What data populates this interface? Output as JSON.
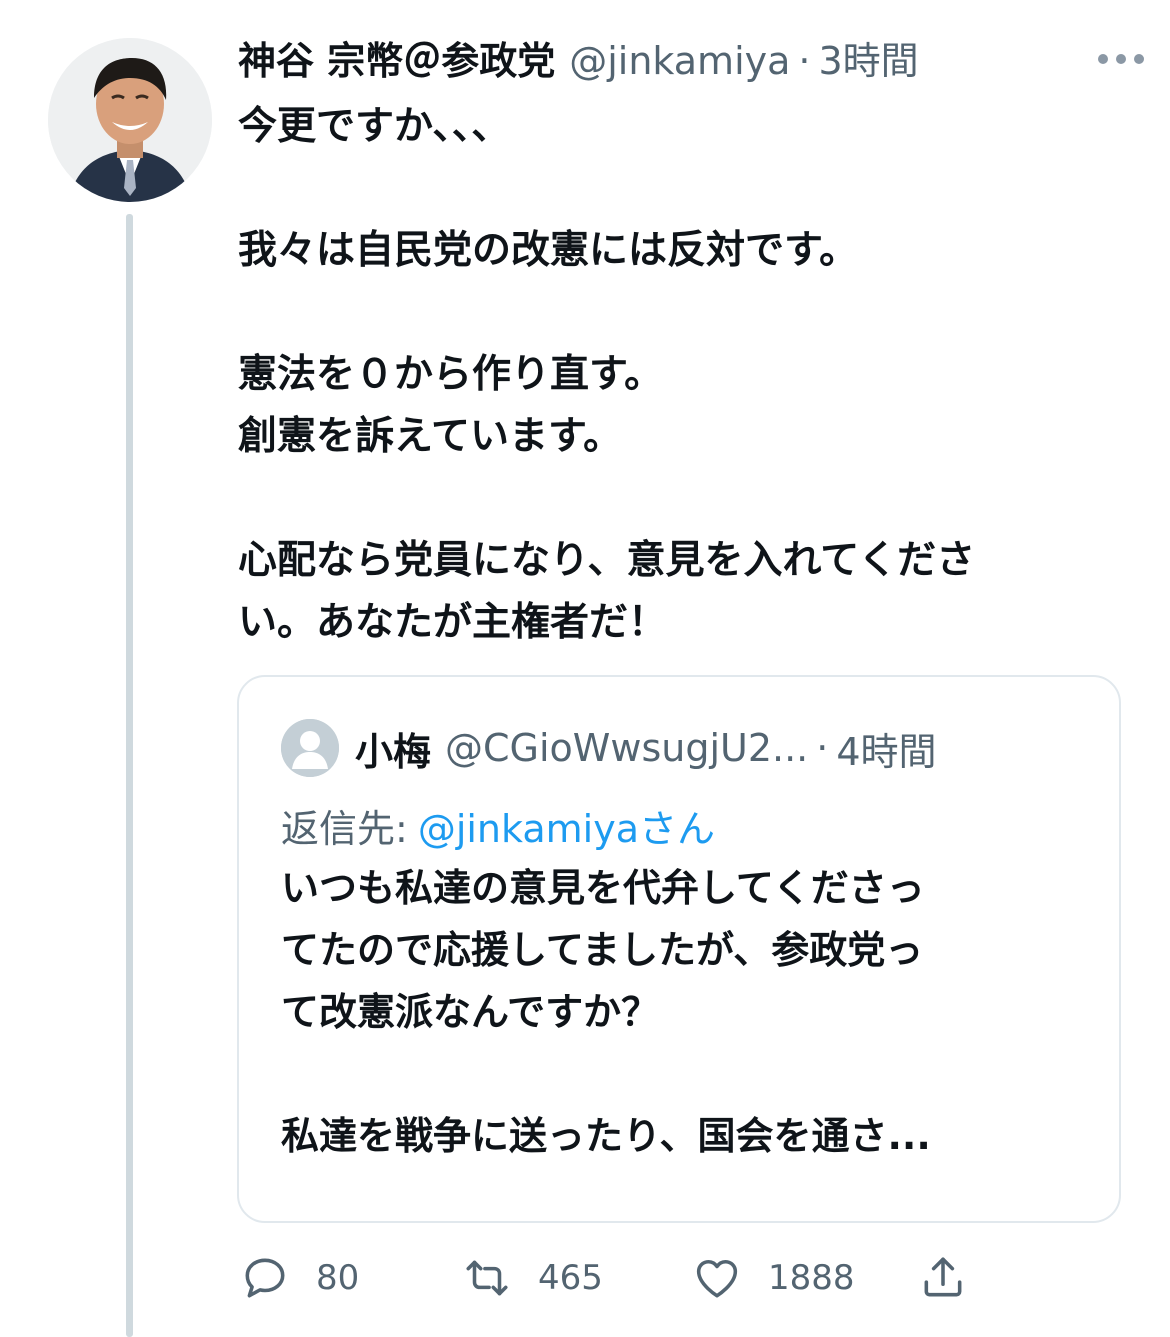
{
  "tweet": {
    "author_name": "神谷 宗幣＠参政党",
    "author_handle": "@jinkamiya",
    "separator": "·",
    "time": "3時間",
    "text": "今更ですか、、、\n\n我々は自民党の改憲には反対です。\n\n憲法を０から作り直す。\n創憲を訴えています。\n\n心配なら党員になり、意見を入れてくださ\nい。あなたが主権者だ！"
  },
  "quoted_tweet": {
    "author_name": "小梅",
    "author_handle": "@CGioWwsugjU2...",
    "separator": "·",
    "time": "4時間",
    "reply_label": "返信先:",
    "reply_mention": "@jinkamiyaさん",
    "text": "いつも私達の意見を代弁してくださっ\nてたので応援してましたが、参政党っ\nて改憲派なんですか？\n\n私達を戦争に送ったり、国会を通さ..."
  },
  "actions": {
    "reply_count": "80",
    "retweet_count": "465",
    "like_count": "1888"
  },
  "icons": {
    "more": "more-icon",
    "reply": "reply-icon",
    "retweet": "retweet-icon",
    "like": "like-icon",
    "share": "share-icon"
  },
  "colors": {
    "text": "#0f1419",
    "secondary": "#536471",
    "link": "#1d9bf0",
    "border": "#e1e8ed",
    "thread_line": "#cfd9de"
  }
}
